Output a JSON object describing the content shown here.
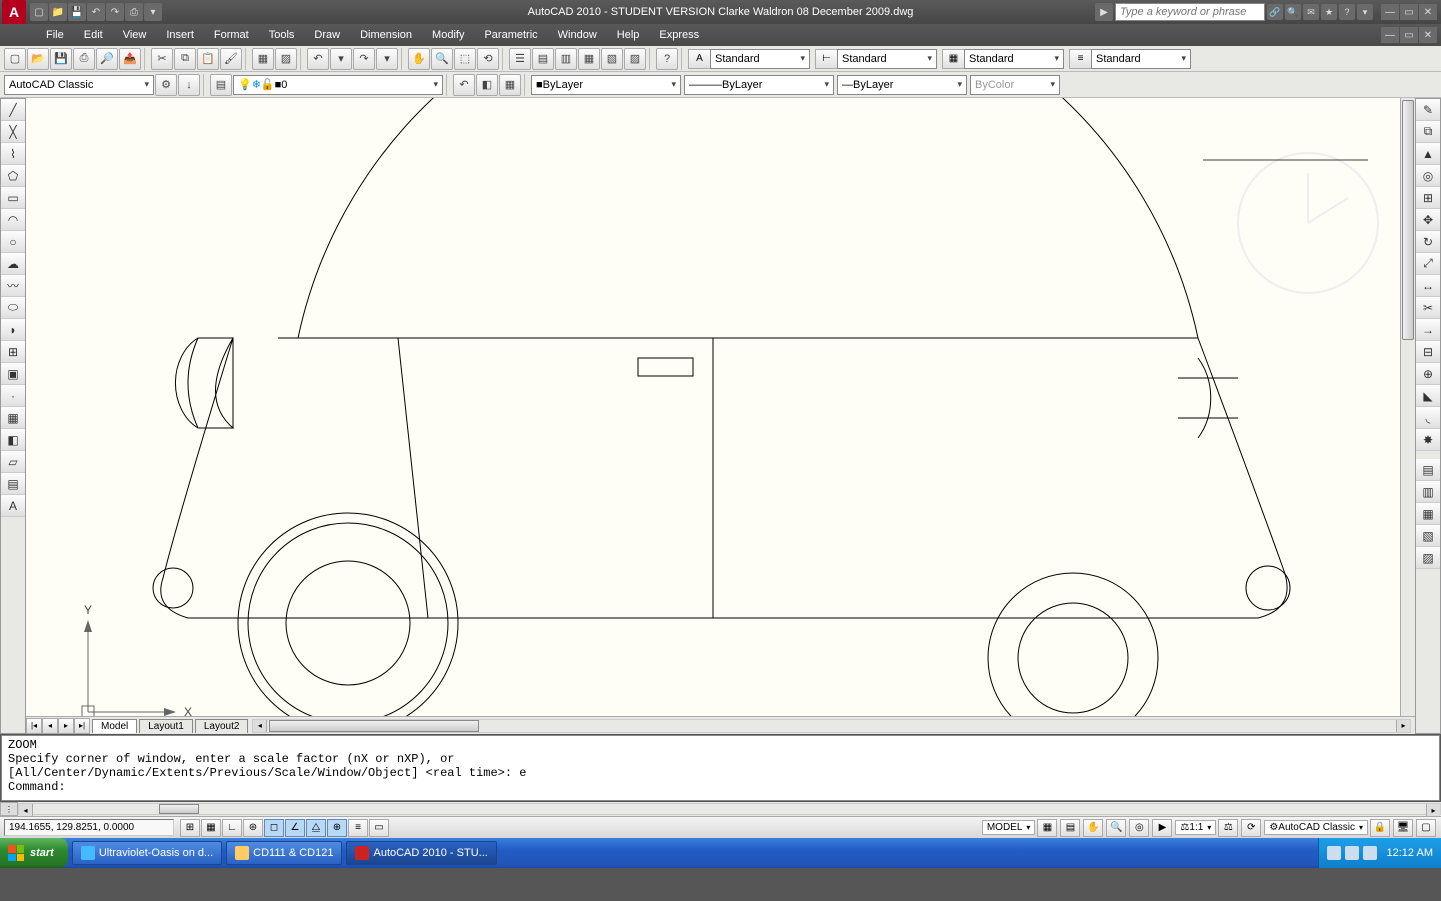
{
  "title": "AutoCAD 2010 - STUDENT VERSION    Clarke Waldron 08 December 2009.dwg",
  "search_placeholder": "Type a keyword or phrase",
  "menus": [
    "File",
    "Edit",
    "View",
    "Insert",
    "Format",
    "Tools",
    "Draw",
    "Dimension",
    "Modify",
    "Parametric",
    "Window",
    "Help",
    "Express"
  ],
  "workspace_combo": "AutoCAD Classic",
  "layer_combo": "0",
  "bylayer1": "ByLayer",
  "bylayer2": "ByLayer",
  "bylayer3": "ByLayer",
  "bycolor": "ByColor",
  "style_combos": {
    "text": "Standard",
    "dim": "Standard",
    "table": "Standard",
    "ml": "Standard"
  },
  "tabs": {
    "model": "Model",
    "l1": "Layout1",
    "l2": "Layout2"
  },
  "cmd": {
    "l1": "ZOOM",
    "l2": "Specify corner of window, enter a scale factor (nX or nXP), or",
    "l3": "[All/Center/Dynamic/Extents/Previous/Scale/Window/Object] <real time>: e",
    "l4": "Command:"
  },
  "status": {
    "coords": "194.1655, 129.8251, 0.0000",
    "model": "MODEL",
    "scale": "1:1",
    "ws": "AutoCAD Classic"
  },
  "axes": {
    "x": "X",
    "y": "Y"
  },
  "taskbar": {
    "start": "start",
    "t1": "Ultraviolet-Oasis on d...",
    "t2": "CD111 & CD121",
    "t3": "AutoCAD 2010 - STU...",
    "clock": "12:12 AM"
  }
}
